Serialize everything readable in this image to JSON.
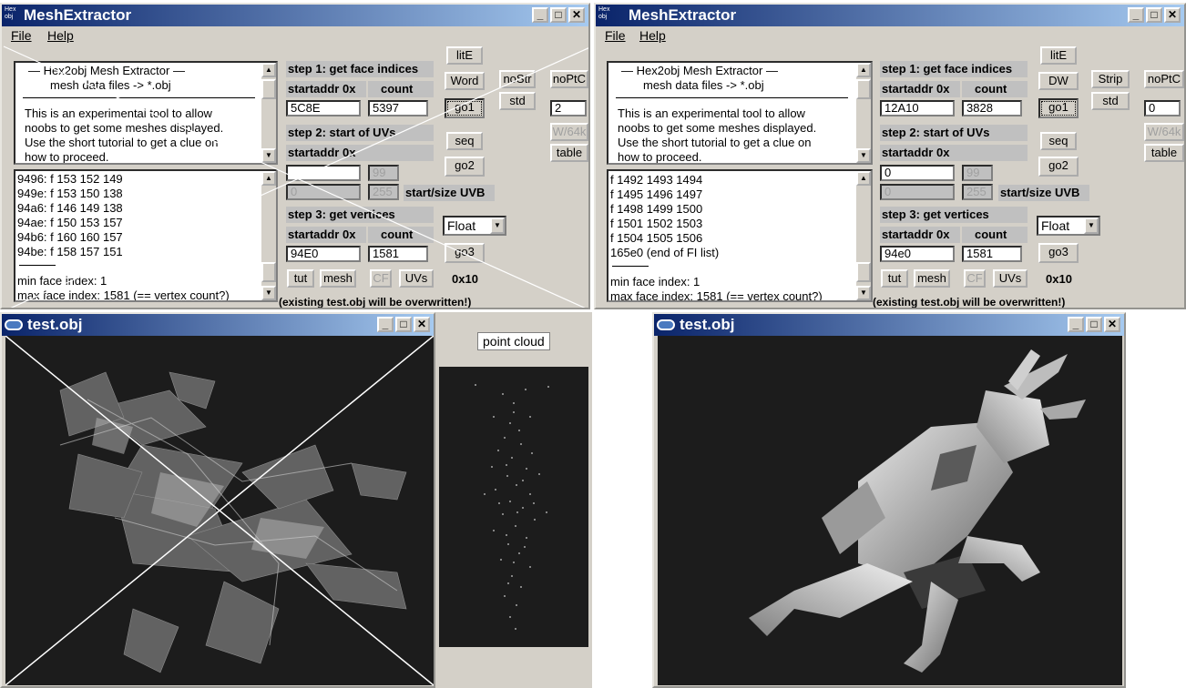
{
  "windows": {
    "left": {
      "title": "MeshExtractor",
      "icon_text": "Hex obj",
      "menu": [
        "File",
        "Help"
      ],
      "header_lines": [
        "—   Hex2obj Mesh Extractor   —",
        "mesh data files -> *.obj"
      ],
      "intro_lines": [
        "This is an experimental tool to allow",
        "noobs to get some meshes displayed.",
        "Use the short tutorial to get a clue on",
        "how to proceed."
      ],
      "output_lines": [
        "9496: f  153 152 149",
        "949e: f  153 150 138",
        "94a6: f  146 149 138",
        "94ae: f  150 153 157",
        "94b6: f  160 160 157",
        "94be: f  158 157 151"
      ],
      "min_face": "min face index: 1",
      "max_face": "max face index: 1581 (== vertex count?)",
      "step1": "step 1: get face indices",
      "step2": "step 2: start of UVs",
      "step3": "step 3: get vertices",
      "startaddr": "startaddr 0x",
      "count": "count",
      "face_start": "5C8E",
      "face_count": "5397",
      "uv_start": "",
      "uv_count": "99",
      "uvb_start": "0",
      "uvb_size": "255",
      "start_size_uvb": "start/size UVB",
      "vert_start": "94E0",
      "vert_count": "1581",
      "type_select": "Float",
      "buttons": {
        "lite": "litE",
        "mode": "Word",
        "nostr": "noStr",
        "noptc": "noPtC",
        "std": "std",
        "go1": "go1",
        "ptc_val": "2",
        "w64": "W/64k",
        "seq": "seq",
        "table": "table",
        "go2": "go2",
        "go3": "go3",
        "tut": "tut",
        "mesh": "mesh",
        "cf": "CF",
        "uvs": "UVs",
        "hex10": "0x10"
      },
      "footer": "(existing test.obj will be overwritten!)"
    },
    "right": {
      "title": "MeshExtractor",
      "icon_text": "Hex obj",
      "menu": [
        "File",
        "Help"
      ],
      "header_lines": [
        "—   Hex2obj Mesh Extractor   —",
        "mesh data files -> *.obj"
      ],
      "intro_lines": [
        "This is an experimental tool to allow",
        "noobs to get some meshes displayed.",
        "Use the short tutorial to get a clue on",
        "how to proceed."
      ],
      "output_lines": [
        "f  1492 1493 1494",
        "f  1495 1496 1497",
        "f  1498 1499 1500",
        "f  1501 1502 1503",
        "f  1504 1505 1506",
        "165e0 (end of FI list)"
      ],
      "min_face": "min face index: 1",
      "max_face": "max face index: 1581 (== vertex count?)",
      "step1": "step 1: get face indices",
      "step2": "step 2: start of UVs",
      "step3": "step 3: get vertices",
      "startaddr": "startaddr 0x",
      "count": "count",
      "face_start": "12A10",
      "face_count": "3828",
      "uv_start": "0",
      "uv_count": "99",
      "uvb_start": "0",
      "uvb_size": "255",
      "start_size_uvb": "start/size UVB",
      "vert_start": "94e0",
      "vert_count": "1581",
      "type_select": "Float",
      "buttons": {
        "lite": "litE",
        "mode": "DW",
        "strip": "Strip",
        "noptc": "noPtC",
        "std": "std",
        "go1": "go1",
        "ptc_val": "0",
        "w64": "W/64k",
        "seq": "seq",
        "table": "table",
        "go2": "go2",
        "go3": "go3",
        "tut": "tut",
        "mesh": "mesh",
        "cf": "CF",
        "uvs": "UVs",
        "hex10": "0x10"
      },
      "footer": "(existing test.obj will be overwritten!)"
    }
  },
  "viewers": {
    "left": {
      "title": "test.obj"
    },
    "right": {
      "title": "test.obj"
    }
  },
  "point_cloud": {
    "label": "point cloud"
  },
  "colors": {
    "title_start": "#0a246a",
    "title_end": "#a6caf0",
    "face": "#d4d0c8",
    "viewport": "#1c1c1c"
  }
}
